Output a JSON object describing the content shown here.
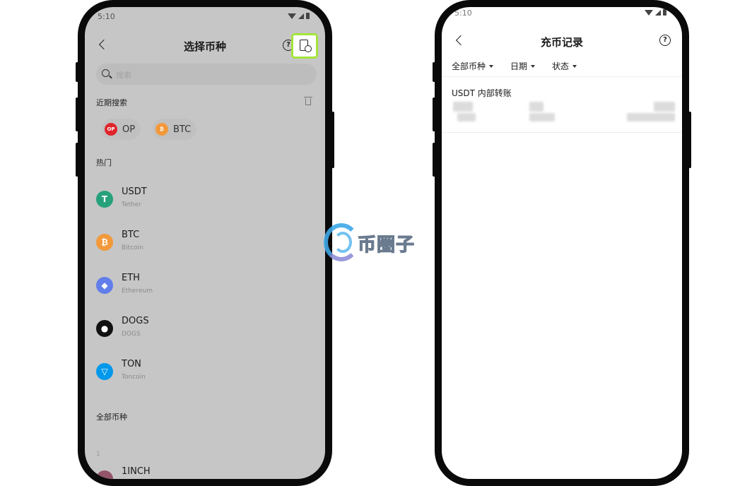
{
  "left_screen": {
    "status_time": "5:10",
    "title": "选择币种",
    "help_label": "?",
    "search_placeholder": "搜索",
    "recent_label": "近期搜索",
    "recent": [
      {
        "symbol": "OP",
        "icon_text": "OP",
        "color": "#e0242b"
      },
      {
        "symbol": "BTC",
        "icon_text": "₿",
        "color": "#f2993b"
      }
    ],
    "hot_label": "热门",
    "hot": [
      {
        "symbol": "USDT",
        "name": "Tether",
        "icon_text": "T",
        "color": "#26a17b"
      },
      {
        "symbol": "BTC",
        "name": "Bitcoin",
        "icon_text": "₿",
        "color": "#f2993b"
      },
      {
        "symbol": "ETH",
        "name": "Ethereum",
        "icon_text": "◆",
        "color": "#627eea"
      },
      {
        "symbol": "DOGS",
        "name": "DOGS",
        "icon_text": "●",
        "color": "#111111"
      },
      {
        "symbol": "TON",
        "name": "Toncoin",
        "icon_text": "▽",
        "color": "#0098ea"
      }
    ],
    "all_label": "全部币种",
    "alpha_index": "1",
    "first_all": "1INCH"
  },
  "right_screen": {
    "status_time": "5:10",
    "title": "充币记录",
    "help_label": "?",
    "filters": [
      "全部币种",
      "日期",
      "状态"
    ],
    "record_title": "USDT 内部转账"
  },
  "watermark": {
    "text": "币圈子"
  },
  "colors": {
    "highlight": "#a4e43c",
    "dim_overlay": "#c6c6c6"
  }
}
